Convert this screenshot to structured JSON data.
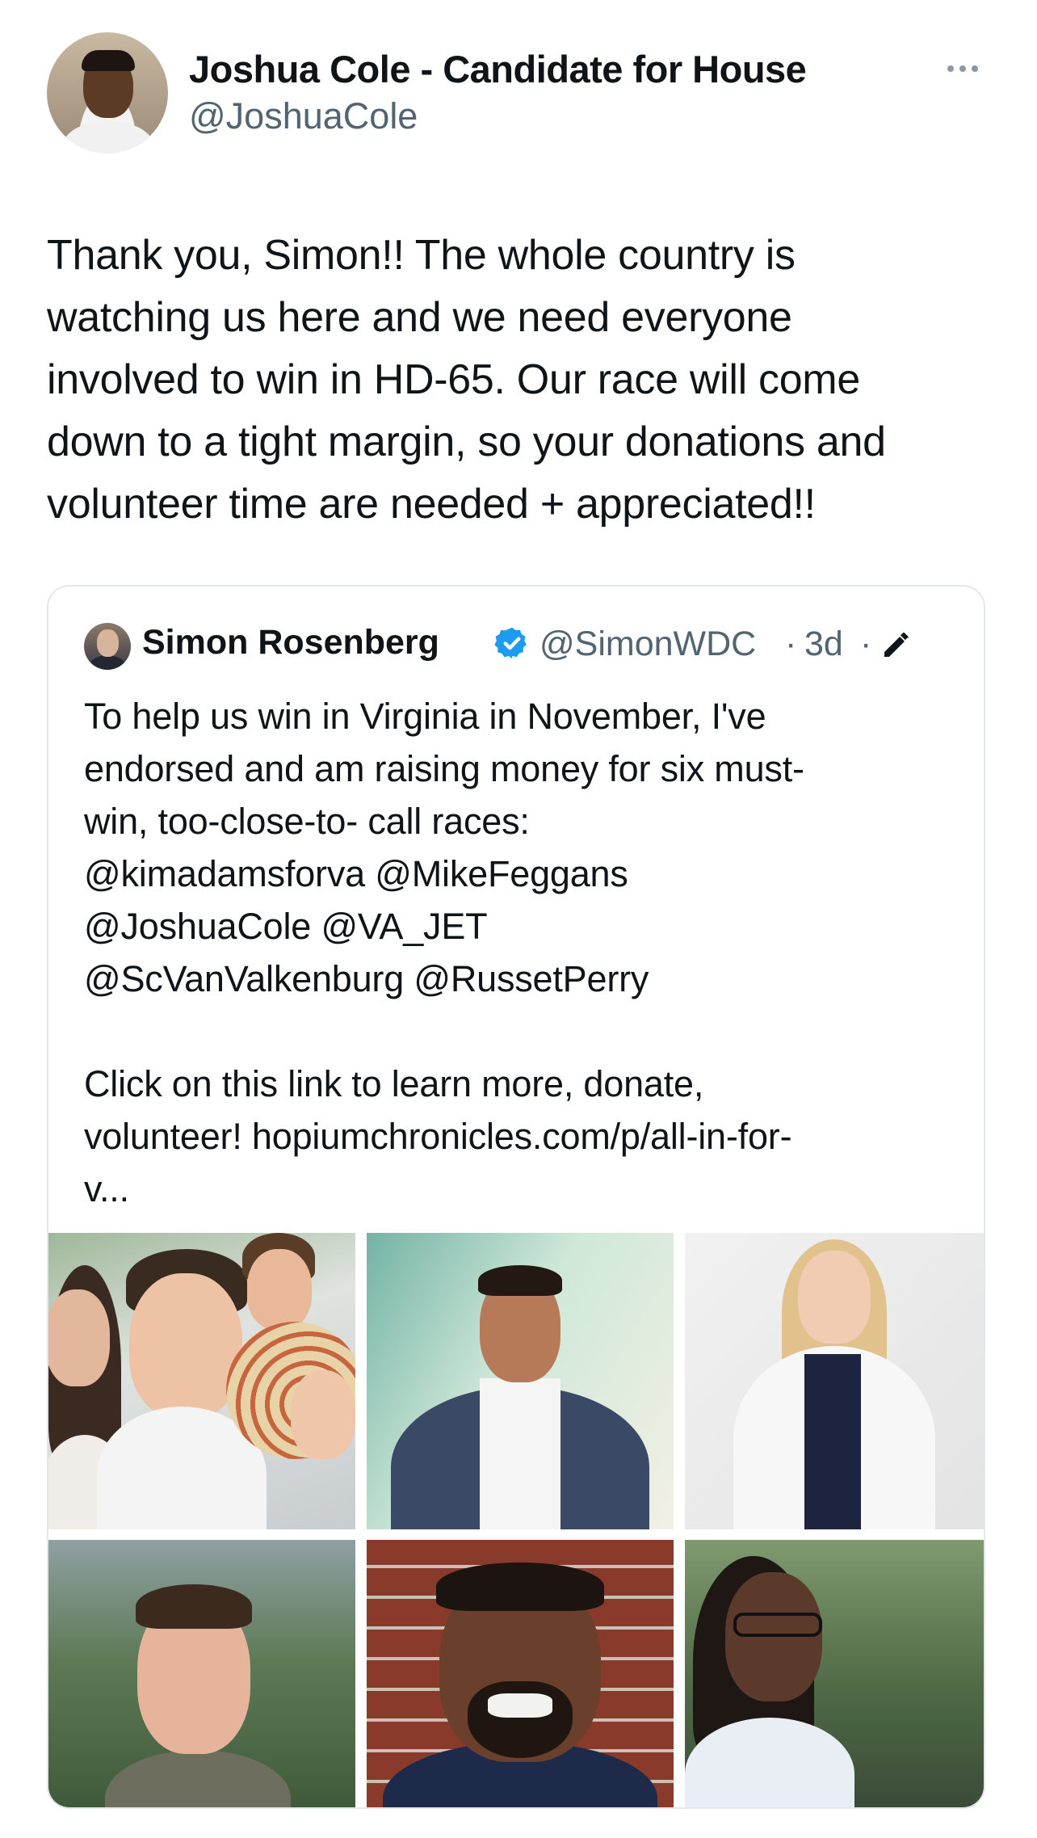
{
  "author": {
    "display_name": "Joshua Cole - Candidate for House",
    "handle": "@JoshuaCole"
  },
  "tweet": {
    "lines": [
      "Thank you, Simon!! The whole country is",
      "watching us here and we need everyone",
      "involved to win in HD-65. Our race will come",
      "down to a tight margin, so your donations and",
      "volunteer time are needed + appreciated!!"
    ]
  },
  "quote": {
    "display_name": "Simon Rosenberg",
    "handle": "@SimonWDC",
    "separator": "·",
    "time": "3d",
    "lines": [
      "To help us win in Virginia in November, I've",
      "endorsed and am raising money for six must-",
      "win, too-close-to- call races:",
      "@kimadamsforva @MikeFeggans",
      "@JoshuaCole @VA_JET",
      "@ScVanValkenburg @RussetPerry",
      "",
      "Click on this link to learn more, donate,",
      "volunteer!  hopiumchronicles.com/p/all-in-for-",
      "v..."
    ]
  },
  "icons": {
    "more": "more-icon",
    "verified": "verified-badge-icon",
    "edit": "edited-pencil-icon"
  },
  "colors": {
    "text": "#0f1419",
    "secondary": "#536471",
    "verified": "#1d9bf0",
    "border": "#e3e7ea"
  }
}
